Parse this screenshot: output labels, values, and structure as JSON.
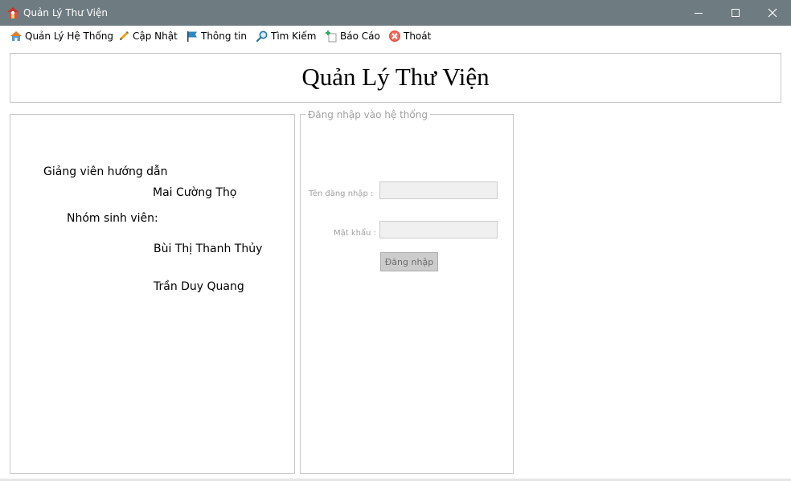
{
  "window": {
    "title": "Quản Lý Thư Viện",
    "icon": "house-icon"
  },
  "menu": {
    "items": [
      {
        "label": "Quản Lý Hệ Thống",
        "icon": "home-icon"
      },
      {
        "label": "Cập Nhật",
        "icon": "pencil-icon"
      },
      {
        "label": "Thông tin",
        "icon": "flag-icon"
      },
      {
        "label": "Tìm Kiếm",
        "icon": "magnifier-icon"
      },
      {
        "label": "Báo Cáo",
        "icon": "add-document-icon"
      },
      {
        "label": "Thoát",
        "icon": "exit-icon"
      }
    ]
  },
  "banner": {
    "title": "Quản Lý Thư Viện"
  },
  "info": {
    "advisor_heading": "Giảng viên hướng dẫn",
    "advisor_name": "Mai Cường Thọ",
    "students_heading": "Nhóm sinh viên:",
    "student_1": "Bùi Thị Thanh Thủy",
    "student_2": "Trần Duy Quang"
  },
  "login": {
    "legend": "Đăng nhập vào hệ thống",
    "username_label": "Tên đăng nhập :",
    "username_value": "",
    "password_label": "Mật khẩu :",
    "password_value": "",
    "submit_label": "Đăng nhập"
  },
  "colors": {
    "titlebar": "#6e7b80",
    "border": "#c8c8c8",
    "disabled_text": "#a0a0a0",
    "button_bg": "#cccccc"
  }
}
